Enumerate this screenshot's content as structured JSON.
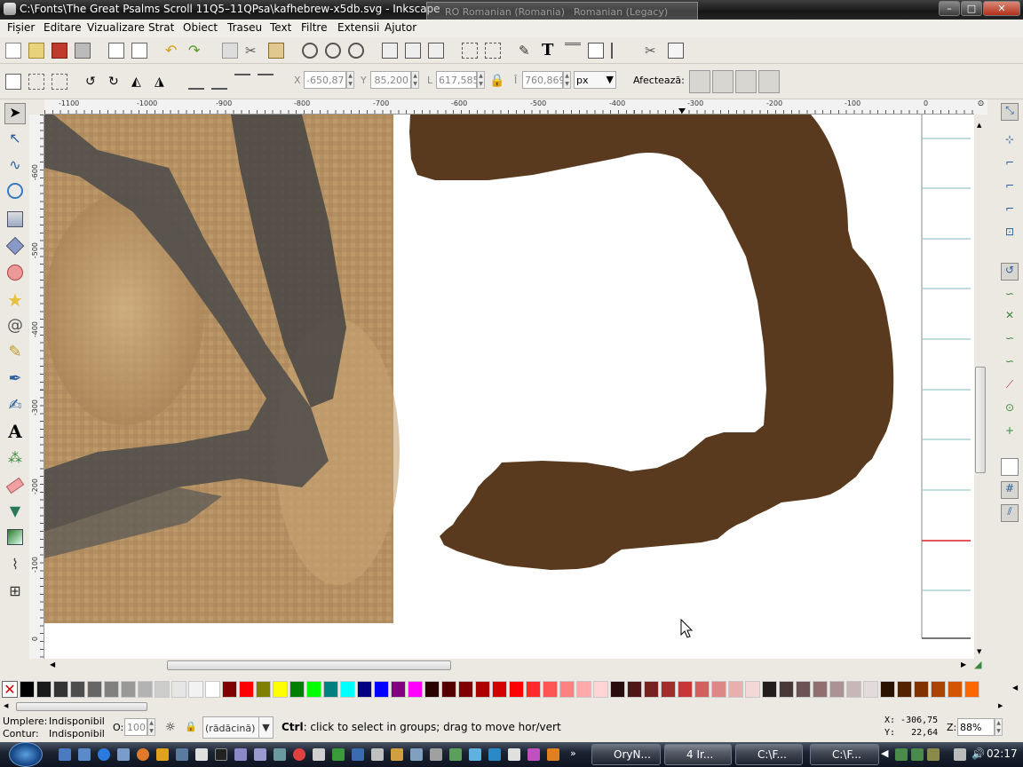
{
  "window": {
    "title": "C:\\Fonts\\The Great Psalms Scroll 11Q5–11QPsa\\kafhebrew-x5db.svg - Inkscape",
    "language_bar": [
      "RO Romanian (Romania)",
      "Romanian (Legacy)"
    ],
    "minimize": "–",
    "maximize": "□",
    "close": "✕"
  },
  "menu": [
    "Fișier",
    "Editare",
    "Vizualizare",
    "Strat",
    "Obiect",
    "Traseu",
    "Text",
    "Filtre",
    "Extensii",
    "Ajutor"
  ],
  "commands_bar": {
    "icons": [
      "new-document-icon",
      "open-icon",
      "save-icon",
      "print-icon",
      "import-icon",
      "export-icon",
      "undo-icon",
      "redo-icon",
      "duplicate-icon",
      "cut-icon",
      "paste-icon",
      "zoom-selection-icon",
      "zoom-drawing-icon",
      "zoom-page-icon",
      "clone-icon",
      "group-icon",
      "ungroup-icon",
      "align-icon",
      "distribute-icon",
      "fill-stroke-icon",
      "text-font-icon",
      "layers-icon",
      "xml-editor-icon",
      "align-distribute-icon",
      "preferences-icon",
      "document-properties-icon"
    ]
  },
  "tool_controls": {
    "x_label": "X",
    "x_value": "-650,87",
    "y_label": "Y",
    "y_value": "85,200",
    "w_label": "L",
    "w_value": "617,585",
    "h_label": "Î",
    "h_value": "760,869",
    "unit": "px",
    "affect_label": "Afectează:"
  },
  "rulers": {
    "horizontal_ticks": [
      "-1100",
      "-1000",
      "-900",
      "-800",
      "-700",
      "-600",
      "-500",
      "-400",
      "-300",
      "-200",
      "-100",
      "0"
    ],
    "vertical_ticks": [
      "-600",
      "-500",
      "-400",
      "-300",
      "-200",
      "-100",
      "0"
    ]
  },
  "toolbox": [
    "selector-tool",
    "node-tool",
    "tweak-tool",
    "zoom-tool",
    "rectangle-tool",
    "3d-box-tool",
    "ellipse-tool",
    "star-tool",
    "spiral-tool",
    "pencil-tool",
    "pen-tool",
    "calligraphy-tool",
    "text-tool",
    "spray-tool",
    "eraser-tool",
    "paint-bucket-tool",
    "gradient-tool",
    "dropper-tool",
    "connector-tool"
  ],
  "snap_controls": [
    "enable-snapping",
    "snap-bbox",
    "snap-bbox-edges",
    "snap-bbox-corners",
    "snap-bbox-midpoints",
    "snap-bbox-center",
    "snap-nodes",
    "snap-paths",
    "snap-intersections",
    "snap-cusp-nodes",
    "snap-smooth-nodes",
    "snap-midpoints",
    "snap-object-center",
    "snap-rotation-center",
    "snap-page-border",
    "snap-grid",
    "snap-guide"
  ],
  "canvas": {
    "glyph_color": "#5a3a1e"
  },
  "palette": {
    "colors": [
      "#000000",
      "#1a1a1a",
      "#333333",
      "#4d4d4d",
      "#666666",
      "#808080",
      "#999999",
      "#b3b3b3",
      "#cccccc",
      "#e6e6e6",
      "#f2f2f2",
      "#ffffff",
      "#800000",
      "#ff0000",
      "#808000",
      "#ffff00",
      "#008000",
      "#00ff00",
      "#008080",
      "#00ffff",
      "#000080",
      "#0000ff",
      "#800080",
      "#ff00ff",
      "#2b0000",
      "#550000",
      "#800000",
      "#aa0000",
      "#d40000",
      "#ff0000",
      "#ff2a2a",
      "#ff5555",
      "#ff8080",
      "#ffaaaa",
      "#ffd5d5",
      "#280b0b",
      "#501616",
      "#782121",
      "#a02c2c",
      "#c83737",
      "#d35f5f",
      "#de8787",
      "#e9afaf",
      "#f4d7d7",
      "#241c1c",
      "#483737",
      "#6c5353",
      "#916f6f",
      "#ac9393",
      "#c8b7b7",
      "#e3dbdb",
      "#2b1100",
      "#552200",
      "#803300",
      "#aa4400",
      "#d45500",
      "#ff6600"
    ]
  },
  "status": {
    "fill_label": "Umplere:",
    "fill_value": "Indisponibil",
    "stroke_label": "Contur:",
    "stroke_value": "Indisponibil",
    "opacity_label": "O:",
    "opacity_value": "100",
    "layer": "(rădăcină)",
    "message_key": "Ctrl",
    "message": ": click to select in groups; drag to move hor/vert",
    "x_coord": "X: -306,75",
    "y_coord": "Y:   22,64",
    "zoom_label": "Z:",
    "zoom_value": "88%"
  },
  "taskbar": {
    "tasks": [
      "OryN...",
      "4 Ir...",
      "C:\\F...",
      "C:\\F..."
    ],
    "clock": "02:17"
  }
}
